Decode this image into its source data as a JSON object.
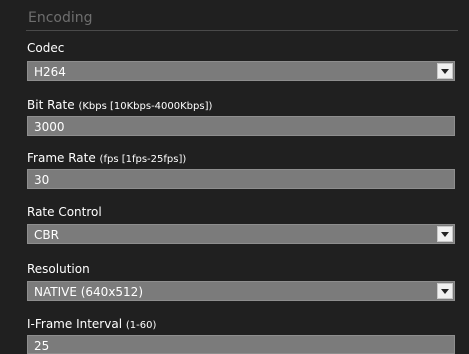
{
  "section": {
    "title": "Encoding"
  },
  "fields": [
    {
      "label": "Codec",
      "hint": "",
      "value": "H264",
      "type": "select"
    },
    {
      "label": "Bit Rate",
      "hint": "(Kbps [10Kbps-4000Kbps])",
      "value": "3000",
      "type": "input"
    },
    {
      "label": "Frame Rate",
      "hint": "(fps [1fps-25fps])",
      "value": "30",
      "type": "input"
    },
    {
      "label": "Rate Control",
      "hint": "",
      "value": "CBR",
      "type": "select"
    },
    {
      "label": "Resolution",
      "hint": "",
      "value": "NATIVE (640x512)",
      "type": "select"
    },
    {
      "label": "I-Frame Interval",
      "hint": "(1-60)",
      "value": "25",
      "type": "input"
    }
  ],
  "icons": {
    "dropdown": "chevron-down-icon"
  }
}
